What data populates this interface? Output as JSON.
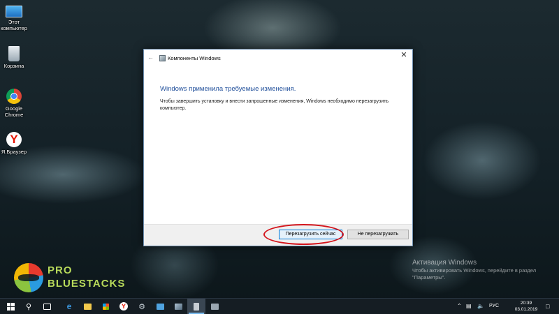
{
  "desktop": {
    "icons": [
      {
        "label": "Этот компьютер",
        "icon": "computer-icon"
      },
      {
        "label": "Корзина",
        "icon": "recycle-bin-icon"
      },
      {
        "label": "Google Chrome",
        "icon": "chrome-icon"
      },
      {
        "label": "Я.Браузер",
        "icon": "yandex-browser-icon"
      }
    ]
  },
  "dialog": {
    "title": "Компоненты Windows",
    "heading": "Windows применила требуемые изменения.",
    "message": "Чтобы завершить установку и внести запрошенные изменения, Windows необходимо перезагрузить компьютер.",
    "primary_button": "Перезагрузить сейчас",
    "secondary_button": "Не перезагружать",
    "highlight_color": "#d4141b"
  },
  "watermark": {
    "activation_title": "Активация Windows",
    "activation_text": "Чтобы активировать Windows, перейдите в раздел \"Параметры\".",
    "logo_line1": "PRO",
    "logo_line2": "BLUESTACKS"
  },
  "taskbar": {
    "items": [
      "start-icon",
      "search-icon",
      "task-view-icon",
      "edge-icon",
      "file-explorer-icon",
      "store-icon",
      "yandex-icon",
      "tool-icon",
      "media-icon",
      "photos-icon",
      "document-icon",
      "app-icon"
    ],
    "language": "РУС",
    "time": "20:39",
    "date": "03.01.2019",
    "accent_color": "#76b9ed"
  }
}
